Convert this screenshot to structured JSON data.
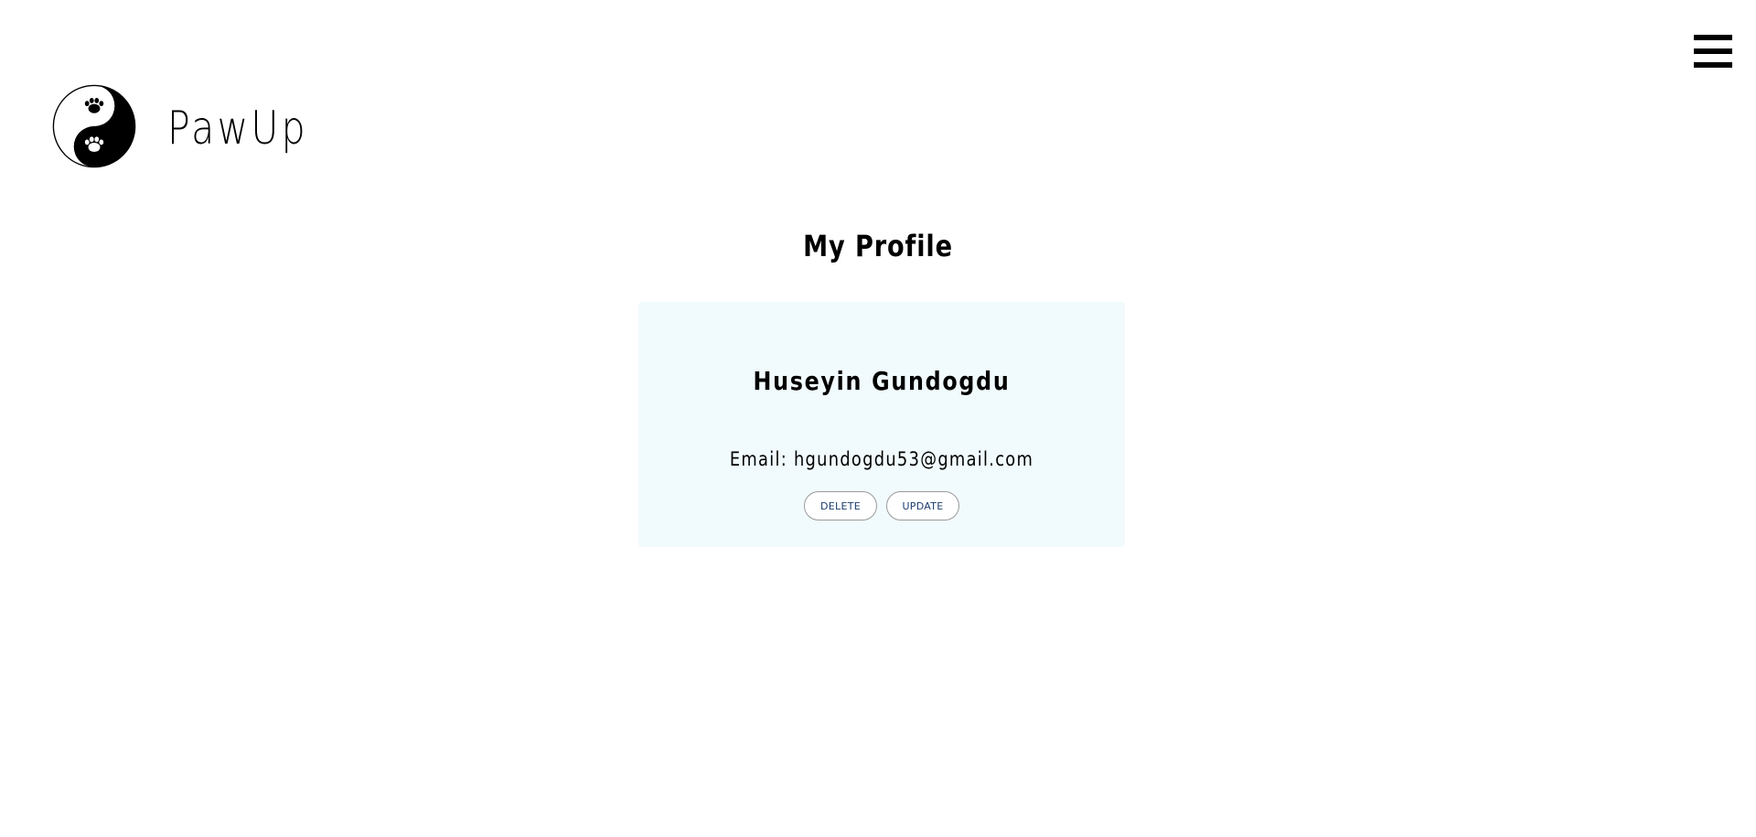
{
  "header": {
    "brand": "PawUp",
    "menu_icon": "hamburger-icon",
    "logo_icon": "yin-yang-paw-icon"
  },
  "main": {
    "title": "My Profile"
  },
  "profile_card": {
    "name": "Huseyin Gundogdu",
    "email": "Email: hgundogdu53@gmail.com",
    "delete_label": "DELETE",
    "update_label": "UPDATE",
    "background": "#f1fafc",
    "button_text_color": "#1c3d6e"
  }
}
